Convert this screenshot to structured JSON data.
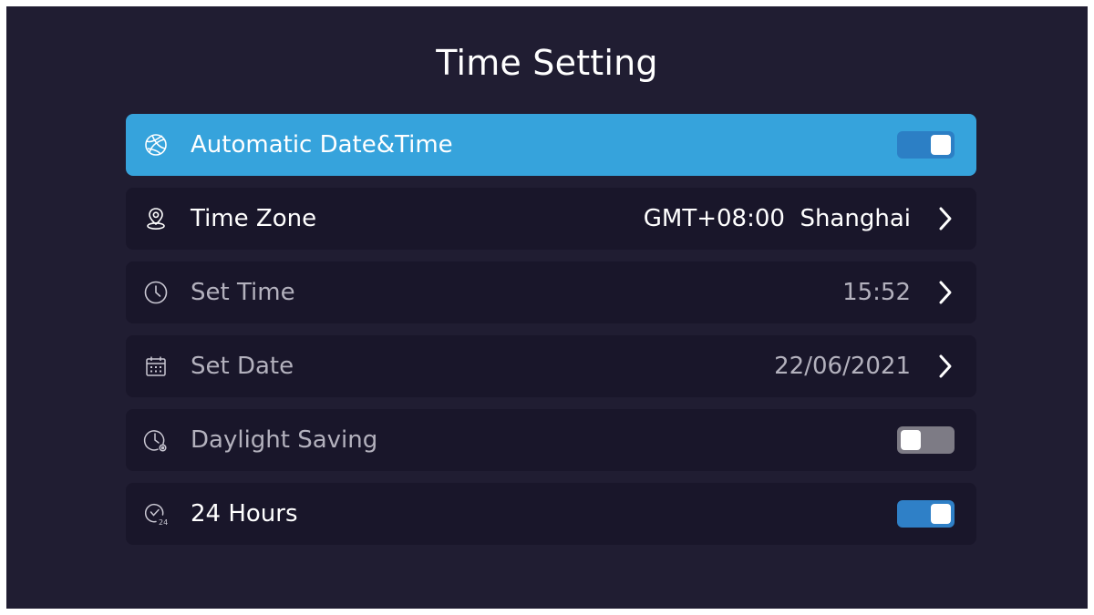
{
  "title": "Time Setting",
  "rows": [
    {
      "icon": "globe-icon",
      "label": "Automatic Date&Time",
      "control": "toggle",
      "toggle_state": "on"
    },
    {
      "icon": "location-pin-icon",
      "label": "Time Zone",
      "control": "chevron",
      "value": "GMT+08:00  Shanghai"
    },
    {
      "icon": "clock-icon",
      "label": "Set Time",
      "control": "chevron",
      "value": "15:52"
    },
    {
      "icon": "calendar-icon",
      "label": "Set Date",
      "control": "chevron",
      "value": "22/06/2021"
    },
    {
      "icon": "daylight-clock-icon",
      "label": "Daylight Saving",
      "control": "toggle",
      "toggle_state": "off"
    },
    {
      "icon": "clock-24-icon",
      "label": "24 Hours",
      "control": "toggle",
      "toggle_state": "on"
    }
  ],
  "colors": {
    "background": "#201d32",
    "row_background": "#19162a",
    "focus_highlight": "#36a3dc",
    "toggle_on": "#2f80c7",
    "toggle_off": "#7d7b85"
  }
}
